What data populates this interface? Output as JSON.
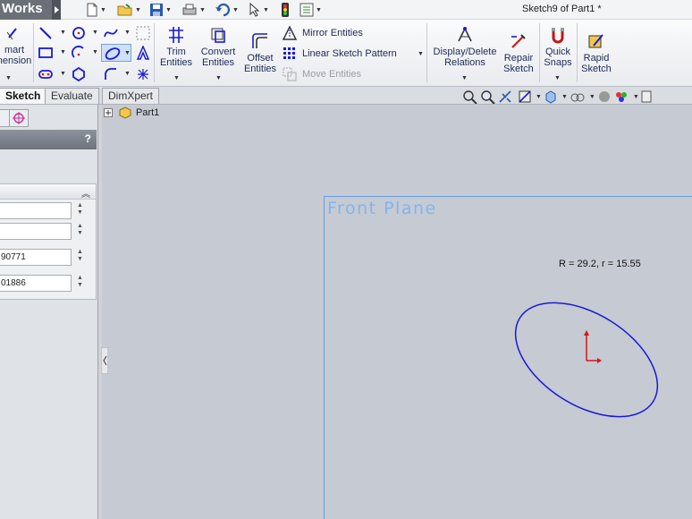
{
  "app": {
    "brand": "Works",
    "document_title": "Sketch9 of Part1 *"
  },
  "ribbon": {
    "smart_dimension": {
      "line1": "mart",
      "line2": "nension"
    },
    "trim_entities": {
      "line1": "Trim",
      "line2": "Entities"
    },
    "convert_entities": {
      "line1": "Convert",
      "line2": "Entities"
    },
    "offset_entities": {
      "line1": "Offset",
      "line2": "Entities"
    },
    "mirror_entities": "Mirror Entities",
    "linear_sketch_pattern": "Linear Sketch Pattern",
    "move_entities": "Move Entities",
    "display_delete_relations": {
      "line1": "Display/Delete",
      "line2": "Relations"
    },
    "repair_sketch": {
      "line1": "Repair",
      "line2": "Sketch"
    },
    "quick_snaps": {
      "line1": "Quick",
      "line2": "Snaps"
    },
    "rapid_sketch": {
      "line1": "Rapid",
      "line2": "Sketch"
    }
  },
  "tabs": [
    {
      "label": "Sketch",
      "active": true
    },
    {
      "label": "Evaluate",
      "active": false
    },
    {
      "label": "DimXpert",
      "active": false
    }
  ],
  "property_manager": {
    "help_label": "?",
    "fields": [
      "",
      "",
      "90771",
      "01886"
    ]
  },
  "tree": {
    "root": "Part1"
  },
  "graphics": {
    "plane_label": "Front Plane",
    "dimension_text": "R = 29.2, r = 15.55"
  },
  "colors": {
    "sketch_entity": "#1a1ad6",
    "origin": "#d01818",
    "plane_border": "#6aa0e0",
    "brand_bg": "#6b6f78"
  }
}
